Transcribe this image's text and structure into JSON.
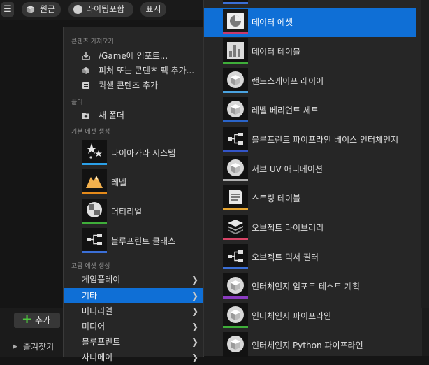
{
  "toolbar": {
    "menu_icon": "hamburger-icon",
    "origin_label": "원근",
    "lighting_label": "라이팅포함",
    "show_label": "표시"
  },
  "menu": {
    "sections": {
      "import": "콘텐츠 가져오기",
      "folder": "폴더",
      "basic": "기본 에셋 생성",
      "advanced": "고급 에셋 생성"
    },
    "import_items": [
      {
        "label": "/Game에 임포트...",
        "icon": "import-icon"
      },
      {
        "label": "피처 또는 콘텐츠 팩 추가...",
        "icon": "content-pack-icon"
      },
      {
        "label": "퀵셀 콘텐츠 추가",
        "icon": "quixel-icon"
      }
    ],
    "folder_items": [
      {
        "label": "새 폴더",
        "icon": "new-folder-icon"
      }
    ],
    "basic_items": [
      {
        "label": "나이아가라 시스템",
        "icon": "niagara-icon",
        "color": "#2ba0e8"
      },
      {
        "label": "레벨",
        "icon": "level-icon",
        "color": "#e58a1a"
      },
      {
        "label": "머티리얼",
        "icon": "material-icon",
        "color": "#3fae3a"
      },
      {
        "label": "블루프린트 클래스",
        "icon": "blueprint-icon",
        "color": "#3b6fd6"
      }
    ],
    "advanced_items": [
      {
        "label": "게임플레이"
      },
      {
        "label": "기타"
      },
      {
        "label": "머티리얼"
      },
      {
        "label": "미디어"
      },
      {
        "label": "블루프린트"
      },
      {
        "label": "사니메이"
      }
    ]
  },
  "submenu": {
    "items": [
      {
        "label": "데이터 에셋",
        "icon": "data-asset-icon",
        "color": "#c8396b"
      },
      {
        "label": "데이터 테이블",
        "icon": "data-table-icon",
        "color": "#3fae3a"
      },
      {
        "label": "랜드스케이프 레이어",
        "icon": "cube-icon",
        "color": "#4aa3e0"
      },
      {
        "label": "레벨 베리언트 세트",
        "icon": "cube-icon",
        "color": "#2a64c9"
      },
      {
        "label": "블루프린트 파이프라인 베이스 인터체인지",
        "icon": "blueprint-icon",
        "color": "#3355c8"
      },
      {
        "label": "서브 UV 애니메이션",
        "icon": "cube-icon",
        "color": "#b0b0b0"
      },
      {
        "label": "스트링 테이블",
        "icon": "string-table-icon",
        "color": "#e7a632"
      },
      {
        "label": "오브젝트 라이브러리",
        "icon": "object-library-icon",
        "color": "#d94467"
      },
      {
        "label": "오브젝트 믹서 필터",
        "icon": "blueprint-icon",
        "color": "#3b6fd6"
      },
      {
        "label": "인터체인지 임포트 테스트 계획",
        "icon": "cube-icon",
        "color": "#8a3cc0"
      },
      {
        "label": "인터체인지 파이프라인",
        "icon": "cube-icon",
        "color": "#3fae3a"
      },
      {
        "label": "인터체인지 Python 파이프라인",
        "icon": "cube-icon",
        "color": "#888888"
      }
    ]
  },
  "bottom": {
    "add_label": "추가",
    "favorites_label": "즐겨찾기"
  }
}
